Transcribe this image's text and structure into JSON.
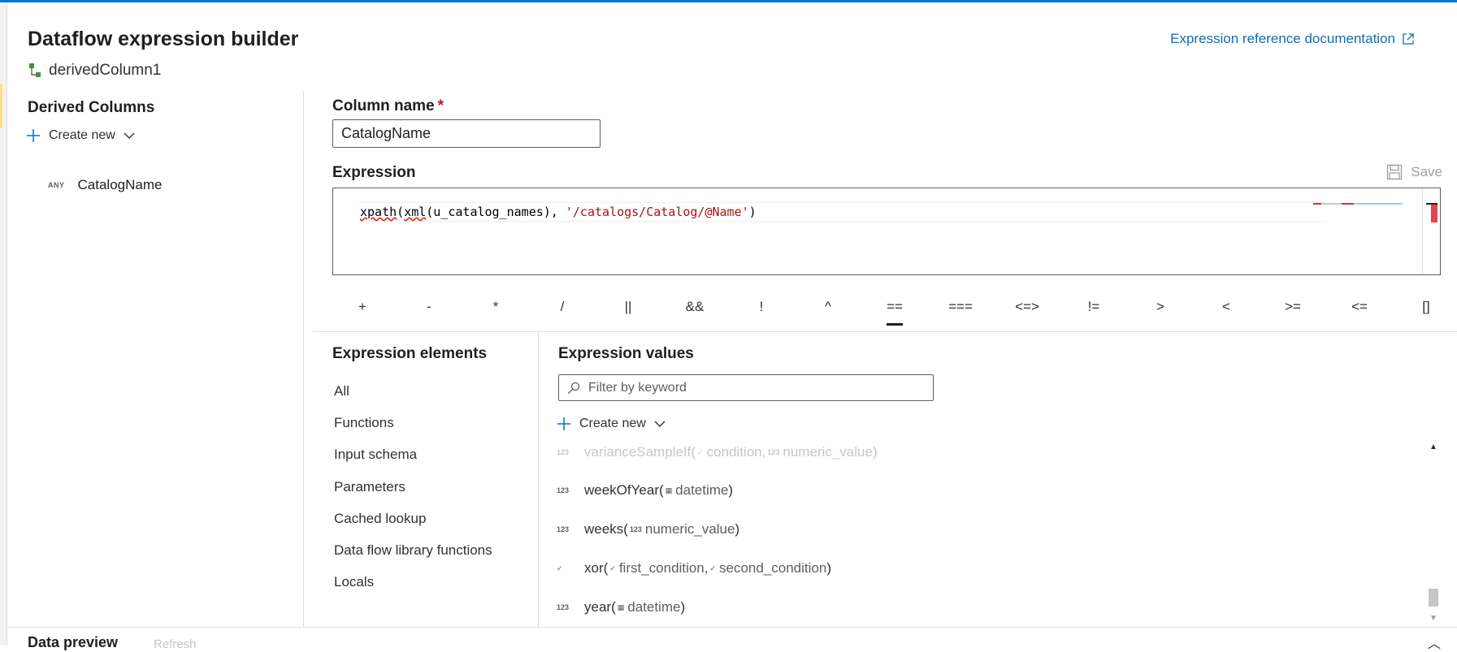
{
  "header": {
    "title": "Dataflow expression builder",
    "subtitle": "derivedColumn1",
    "doc_link": "Expression reference documentation"
  },
  "derived_columns": {
    "heading": "Derived Columns",
    "create_new": "Create new",
    "items": [
      {
        "type": "ANY",
        "name": "CatalogName"
      }
    ]
  },
  "column_name": {
    "label": "Column name",
    "required_mark": "*",
    "value": "CatalogName"
  },
  "expression": {
    "label": "Expression",
    "save_label": "Save",
    "code_fn1": "xpath",
    "code_p1": "(",
    "code_fn2": "xml",
    "code_mid": "(u_catalog_names), ",
    "code_str": "'/catalogs/Catalog/@Name'",
    "code_end": ")"
  },
  "operators": [
    "+",
    "-",
    "*",
    "/",
    "||",
    "&&",
    "!",
    "^",
    "==",
    "===",
    "<=>",
    "!=",
    ">",
    "<",
    ">=",
    "<=",
    "[]"
  ],
  "elements": {
    "heading": "Expression elements",
    "items": [
      "All",
      "Functions",
      "Input schema",
      "Parameters",
      "Cached lookup",
      "Data flow library functions",
      "Locals"
    ]
  },
  "values": {
    "heading": "Expression values",
    "filter_placeholder": "Filter by keyword",
    "create_new": "Create new",
    "functions": [
      {
        "ret": "123",
        "name": "varianceSampleIf(",
        "p1t": "✓",
        "p1": "condition",
        "sep": " , ",
        "p2t": "123",
        "p2": "numeric_value",
        "close": ")"
      },
      {
        "ret": "123",
        "name": "weekOfYear(",
        "p1t": "▦",
        "p1": "datetime",
        "close": ")"
      },
      {
        "ret": "123",
        "name": "weeks(",
        "p1t": "123",
        "p1": "numeric_value",
        "close": ")"
      },
      {
        "ret": "✓",
        "name": "xor(",
        "p1t": "✓",
        "p1": "first_condition",
        "sep": " , ",
        "p2t": "✓",
        "p2": "second_condition",
        "close": ")"
      },
      {
        "ret": "123",
        "name": "year(",
        "p1t": "▦",
        "p1": "datetime",
        "close": ")"
      }
    ]
  },
  "bottom": {
    "data_preview": "Data preview",
    "refresh": "Refresh"
  }
}
